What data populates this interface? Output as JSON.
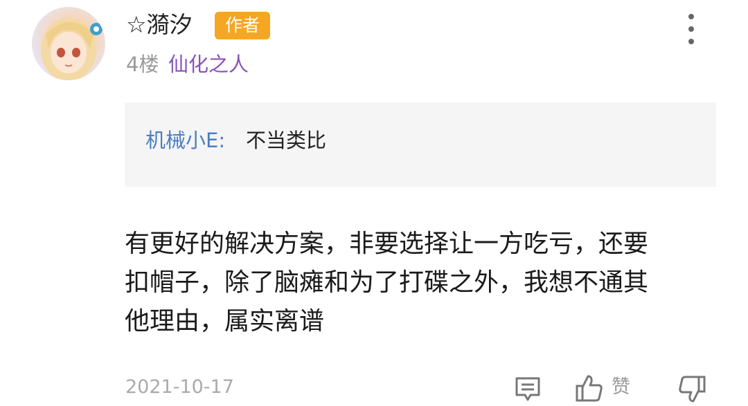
{
  "post": {
    "username": "☆漪汐",
    "author_badge": "作者",
    "floor": "4楼",
    "level_title": "仙化之人",
    "quote": {
      "name": "机械小E:",
      "text": "不当类比"
    },
    "body_lines": [
      "有更好的解决方案，非要选择让一方吃亏，还要",
      "扣帽子，除了脑瘫和为了打碟之外，我想不通其",
      "他理由，属实离谱"
    ],
    "date": "2021-10-17",
    "like_label": "赞"
  },
  "icons": {
    "more": "more-vertical-icon",
    "reply": "comment-icon",
    "like": "thumbs-up-icon",
    "dislike": "thumbs-down-icon"
  },
  "colors": {
    "author_badge": "#f5a623",
    "level_title": "#8a53b8",
    "quote_name": "#4a7ec2",
    "quote_bg": "#f5f5f5"
  }
}
